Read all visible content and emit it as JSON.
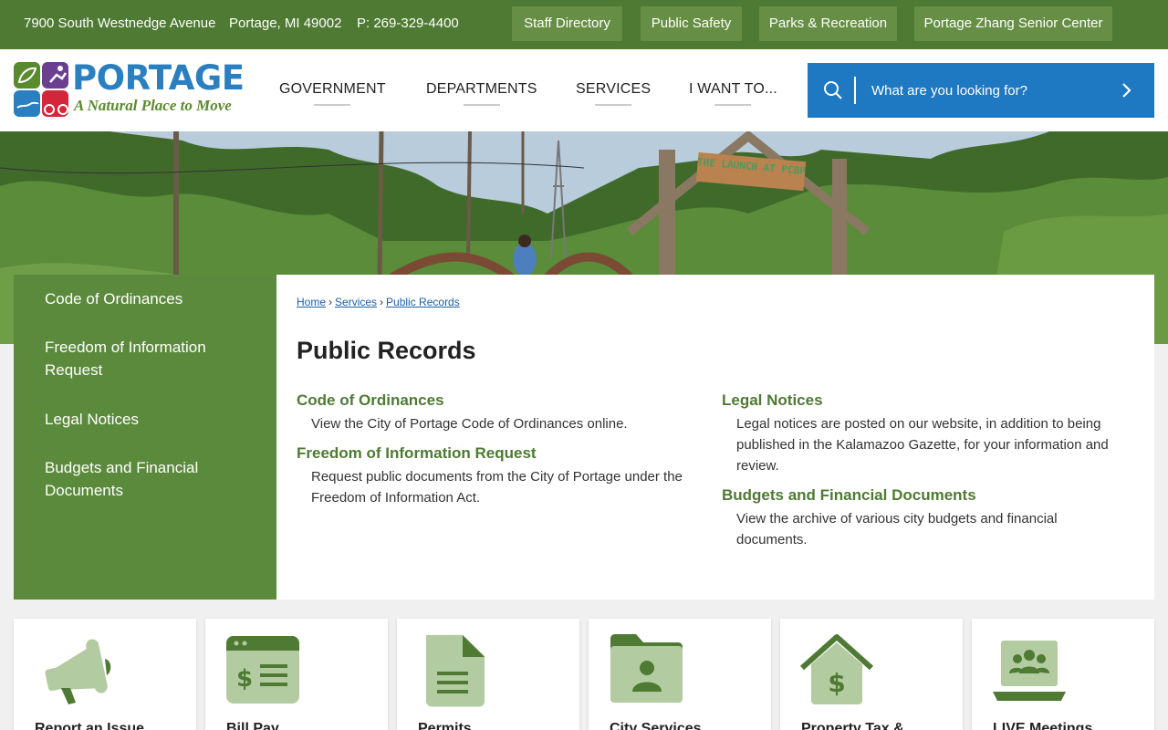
{
  "topbar": {
    "address": "7900 South Westnedge Avenue",
    "city": "Portage, MI 49002",
    "phone": "P: 269-329-4400",
    "links": [
      "Staff Directory",
      "Public Safety",
      "Parks & Recreation",
      "Portage Zhang Senior Center"
    ]
  },
  "logo": {
    "word": "PORTAGE",
    "tagline": "A Natural Place to Move"
  },
  "nav": [
    "GOVERNMENT",
    "DEPARTMENTS",
    "SERVICES",
    "I WANT TO..."
  ],
  "search": {
    "placeholder": "What are you looking for?"
  },
  "hero": {
    "sign_text": "THE LAUNCH AT PCBP"
  },
  "sidebar": {
    "items": [
      "Code of Ordinances",
      "Freedom of Information Request",
      "Legal Notices",
      "Budgets and Financial Documents"
    ]
  },
  "breadcrumb": {
    "items": [
      "Home",
      "Services",
      "Public Records"
    ],
    "separator": "›"
  },
  "page_title": "Public Records",
  "entries": [
    {
      "title": "Code of Ordinances",
      "desc": "View the City of Portage Code of Ordinances online."
    },
    {
      "title": "Freedom of Information Request",
      "desc": "Request public documents from the City of Portage under the Freedom of Information Act."
    },
    {
      "title": "Legal Notices",
      "desc": "Legal notices are posted on our website, in addition to being published in the Kalamazoo Gazette, for your information and review."
    },
    {
      "title": "Budgets and Financial Documents",
      "desc": "View the archive of various city budgets and financial documents."
    }
  ],
  "cards": [
    {
      "label": "Report an Issue",
      "icon": "megaphone-icon"
    },
    {
      "label": "Bill Pay",
      "icon": "bill-pay-icon"
    },
    {
      "label": "Permits",
      "icon": "document-icon"
    },
    {
      "label": "City Services",
      "icon": "folder-person-icon"
    },
    {
      "label": "Property Tax &",
      "icon": "house-dollar-icon"
    },
    {
      "label": "LIVE Meetings",
      "icon": "laptop-group-icon"
    }
  ],
  "colors": {
    "green_dark": "#4e7a33",
    "green_mid": "#5b8a3c",
    "green_button": "#668f45",
    "blue": "#1e78c2",
    "icon_light": "#b3cba0",
    "icon_dark": "#4e7a33"
  }
}
